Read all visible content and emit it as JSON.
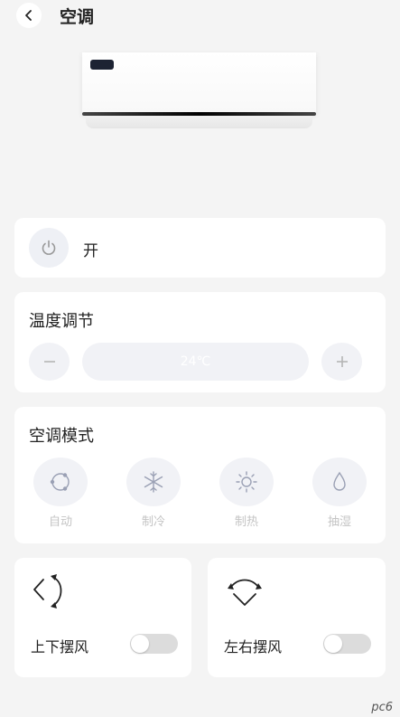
{
  "header": {
    "title": "空调"
  },
  "power": {
    "label": "开"
  },
  "temperature": {
    "title": "温度调节",
    "value": "24℃"
  },
  "mode": {
    "title": "空调模式",
    "items": [
      {
        "label": "自动",
        "icon": "auto-icon"
      },
      {
        "label": "制冷",
        "icon": "snowflake-icon"
      },
      {
        "label": "制热",
        "icon": "sun-icon"
      },
      {
        "label": "抽湿",
        "icon": "droplet-icon"
      }
    ]
  },
  "swing": {
    "vertical_label": "上下摆风",
    "vertical_on": false,
    "horizontal_label": "左右摆风",
    "horizontal_on": false
  },
  "watermark": "pc6",
  "colors": {
    "background": "#f4f4f4",
    "card": "#ffffff",
    "icon_bg": "#f1f2f6",
    "disabled_text": "#c4c4c4"
  }
}
